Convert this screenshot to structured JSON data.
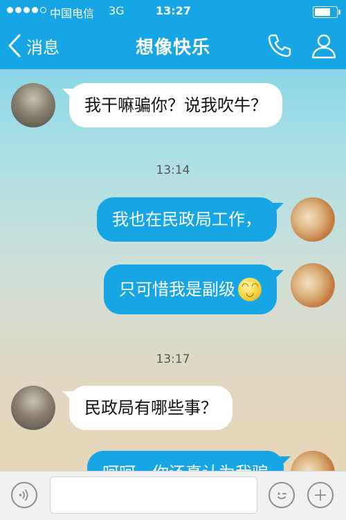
{
  "status_bar": {
    "carrier": "中国电信",
    "network": "3G",
    "time": "13:27"
  },
  "header": {
    "back_label": "消息",
    "title": "想像快乐",
    "call_icon": "phone-icon",
    "profile_icon": "person-icon"
  },
  "messages": [
    {
      "from": "friend",
      "text": "我干嘛骗你？说我吹牛？"
    },
    {
      "type": "time",
      "text": "13:14"
    },
    {
      "from": "me",
      "text": "我也在民政局工作，"
    },
    {
      "from": "me",
      "text": "只可惜我是副级",
      "emoji": "smile-emoji"
    },
    {
      "type": "time",
      "text": "13:17"
    },
    {
      "from": "friend",
      "text": "民政局有哪些事？"
    },
    {
      "from": "me",
      "text": "呵呵，你还真认为我骗"
    }
  ],
  "input_bar": {
    "voice_icon": "voice-icon",
    "emoji_icon": "emoji-icon",
    "plus_icon": "plus-icon",
    "input_value": ""
  },
  "colors": {
    "accent": "#16a6e5",
    "incoming_bubble": "#ffffff",
    "outgoing_bubble": "#16a6e5"
  }
}
